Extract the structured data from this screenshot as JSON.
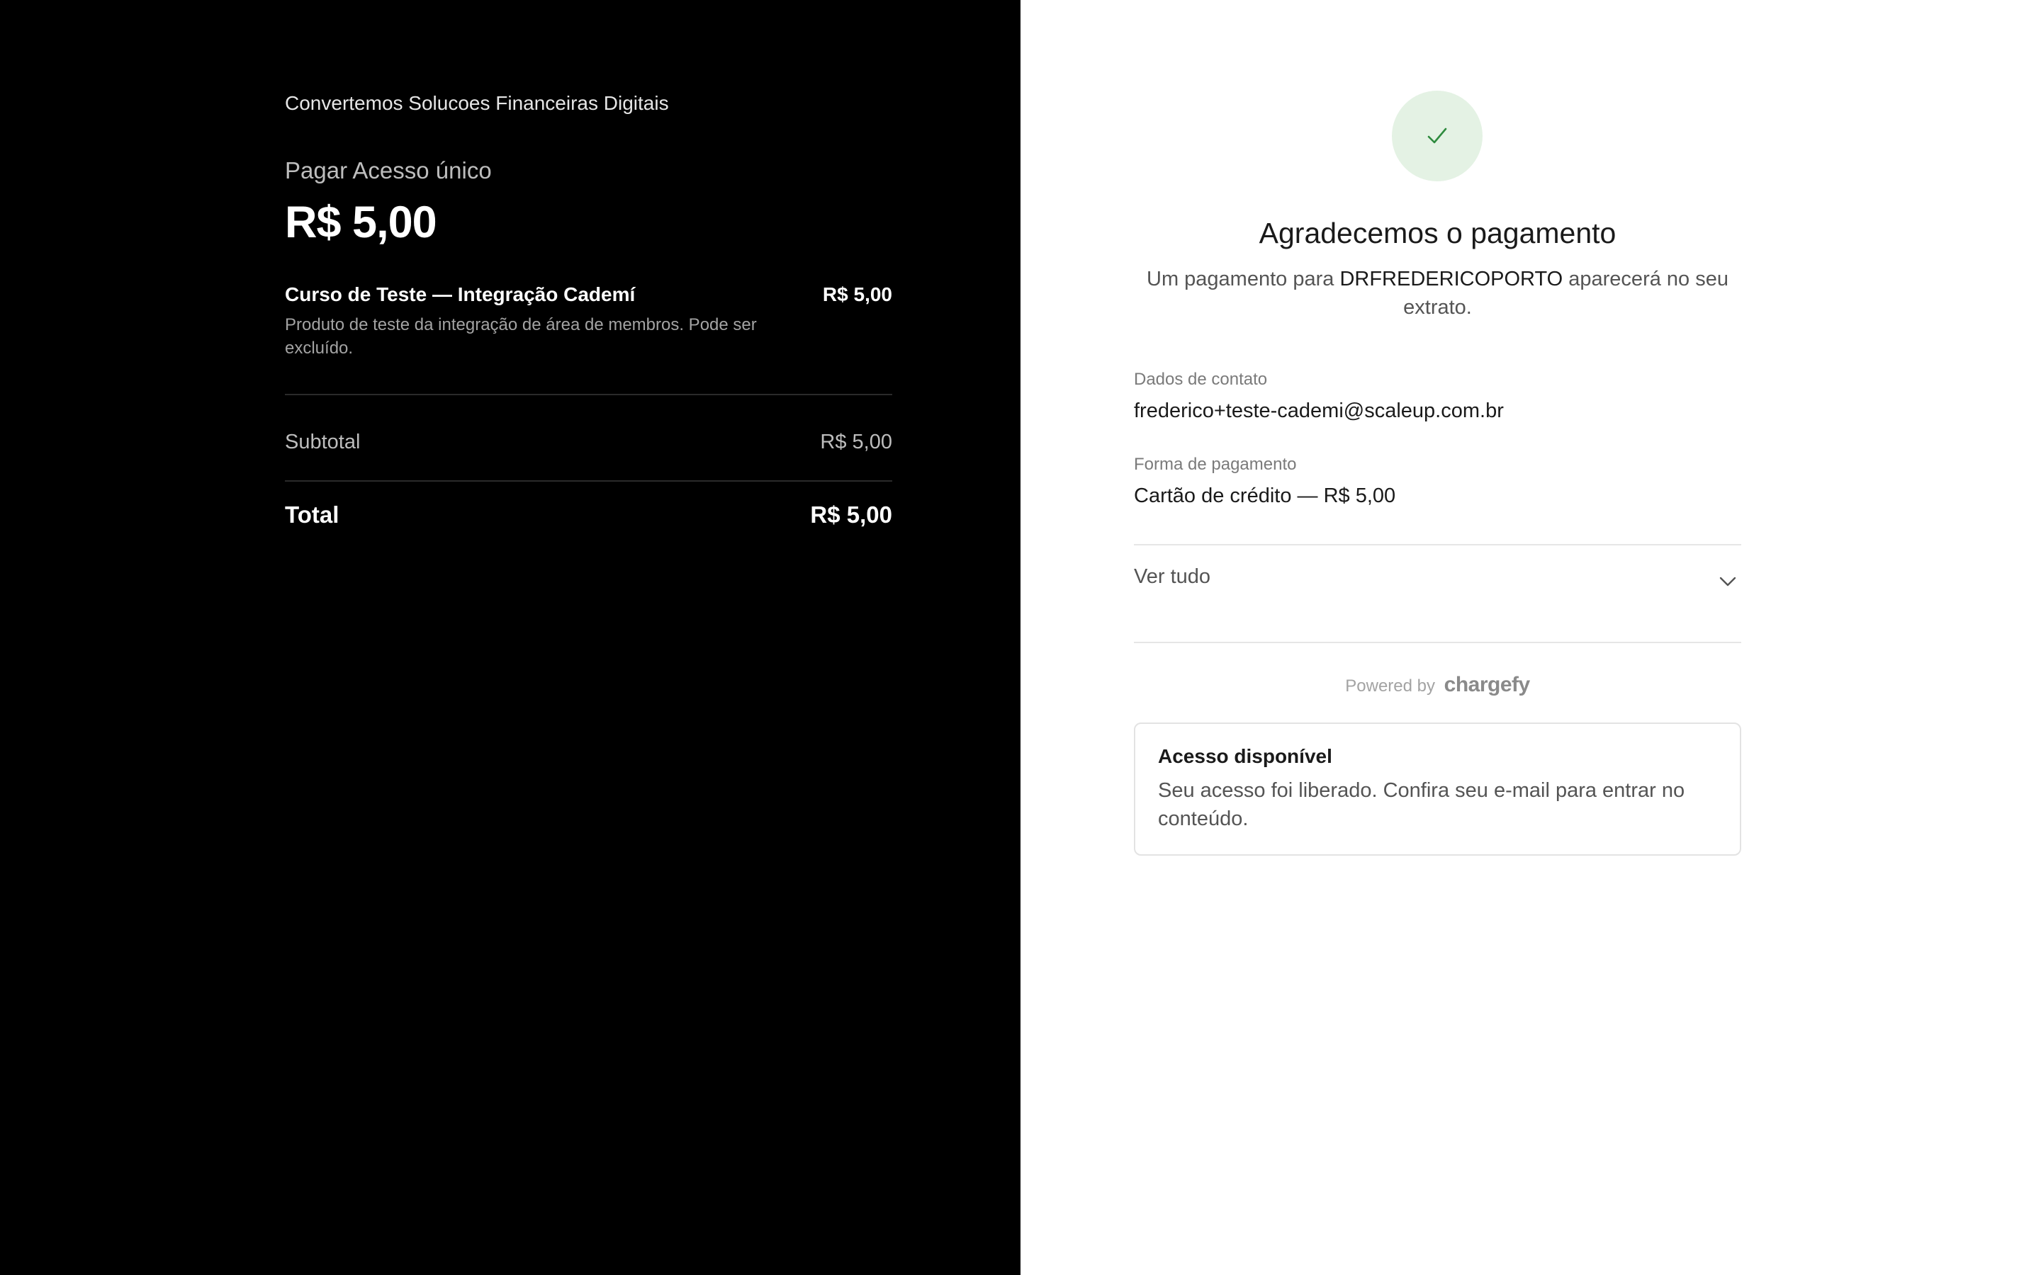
{
  "summary": {
    "merchant": "Convertemos Solucoes Financeiras Digitais",
    "plan_name": "Pagar Acesso único",
    "plan_price": "R$ 5,00",
    "product": {
      "name": "Curso de Teste — Integração Cademí",
      "price": "R$ 5,00",
      "description": "Produto de teste da integração de área de membros. Pode ser excluído."
    },
    "subtotal_label": "Subtotal",
    "subtotal_value": "R$ 5,00",
    "total_label": "Total",
    "total_value": "R$ 5,00"
  },
  "confirmation": {
    "success_icon": "check-icon",
    "title": "Agradecemos o pagamento",
    "subtitle_prefix": "Um pagamento para",
    "statement_name": "DRFREDERICOPORTO",
    "subtitle_suffix": "aparecerá no seu extrato.",
    "contact_label": "Dados de contato",
    "contact_value": "frederico+teste-cademi@scaleup.com.br",
    "payment_label": "Forma de pagamento",
    "payment_value": "Cartão de crédito — R$ 5,00",
    "see_all_label": "Ver tudo",
    "see_all_icon": "chevron-down-icon",
    "powered_by": "Powered by",
    "powered_brand": "chargefy",
    "notice_title": "Acesso disponível",
    "notice_body": "Seu acesso foi liberado. Confira seu e-mail para entrar no conteúdo."
  },
  "colors": {
    "left_background": "#000000",
    "right_background": "#ffffff",
    "success_circle": "#e4f2e4",
    "success_check": "#2e8b3e"
  }
}
